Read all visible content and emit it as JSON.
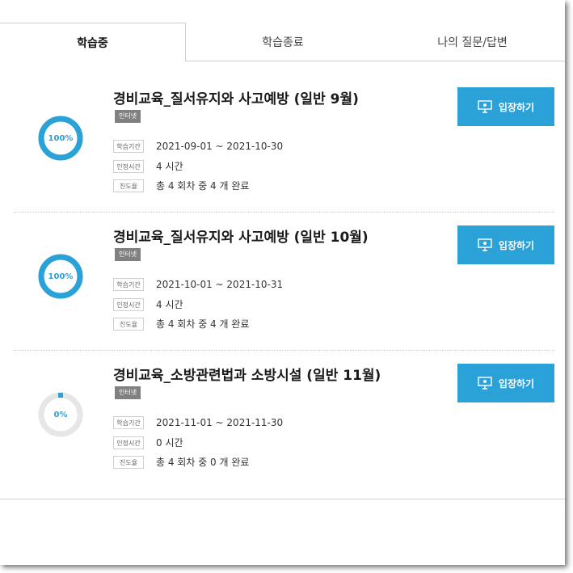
{
  "tabs": [
    {
      "label": "학습중",
      "active": true
    },
    {
      "label": "학습종료",
      "active": false
    },
    {
      "label": "나의 질문/답변",
      "active": false
    }
  ],
  "info_labels": {
    "period": "학습기간",
    "recognized": "인정시간",
    "progress": "진도율"
  },
  "courses": [
    {
      "title": "경비교육_질서유지와 사고예방 (일반 9월)",
      "badge": "인터넷",
      "progress_text": "100%",
      "progress_fraction": 1.0,
      "period": "2021-09-01 ~ 2021-10-30",
      "recognized_time": "4 시간",
      "progress_detail": "총 4 회차 중 4 개 완료",
      "button_label": "입장하기"
    },
    {
      "title": "경비교육_질서유지와 사고예방 (일반 10월)",
      "badge": "인터넷",
      "progress_text": "100%",
      "progress_fraction": 1.0,
      "period": "2021-10-01 ~ 2021-10-31",
      "recognized_time": "4 시간",
      "progress_detail": "총 4 회차 중 4 개 완료",
      "button_label": "입장하기"
    },
    {
      "title": "경비교육_소방관련법과 소방시설 (일반 11월)",
      "badge": "인터넷",
      "progress_text": "0%",
      "progress_fraction": 0.0,
      "period": "2021-11-01 ~ 2021-11-30",
      "recognized_time": "0 시간",
      "progress_detail": "총 4 회차 중 0 개 완료",
      "button_label": "입장하기"
    }
  ],
  "colors": {
    "accent": "#2aa1d7",
    "ring_track": "#e6e6e6",
    "badge": "#808080"
  },
  "icons": {
    "enter_button": "monitor-icon"
  }
}
